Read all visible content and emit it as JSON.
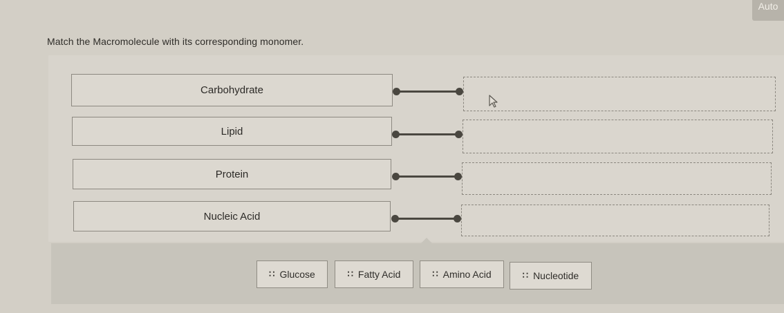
{
  "badge": {
    "label": "Auto"
  },
  "question": {
    "text": "Match the Macromolecule with its corresponding monomer."
  },
  "terms": [
    {
      "label": "Carbohydrate"
    },
    {
      "label": "Lipid"
    },
    {
      "label": "Protein"
    },
    {
      "label": "Nucleic Acid"
    }
  ],
  "choices": [
    {
      "label": "Glucose",
      "icon": "drag-grip-icon"
    },
    {
      "label": "Fatty Acid",
      "icon": "drag-grip-icon"
    },
    {
      "label": "Amino Acid",
      "icon": "drag-grip-icon"
    },
    {
      "label": "Nucleotide",
      "icon": "drag-grip-icon"
    }
  ]
}
